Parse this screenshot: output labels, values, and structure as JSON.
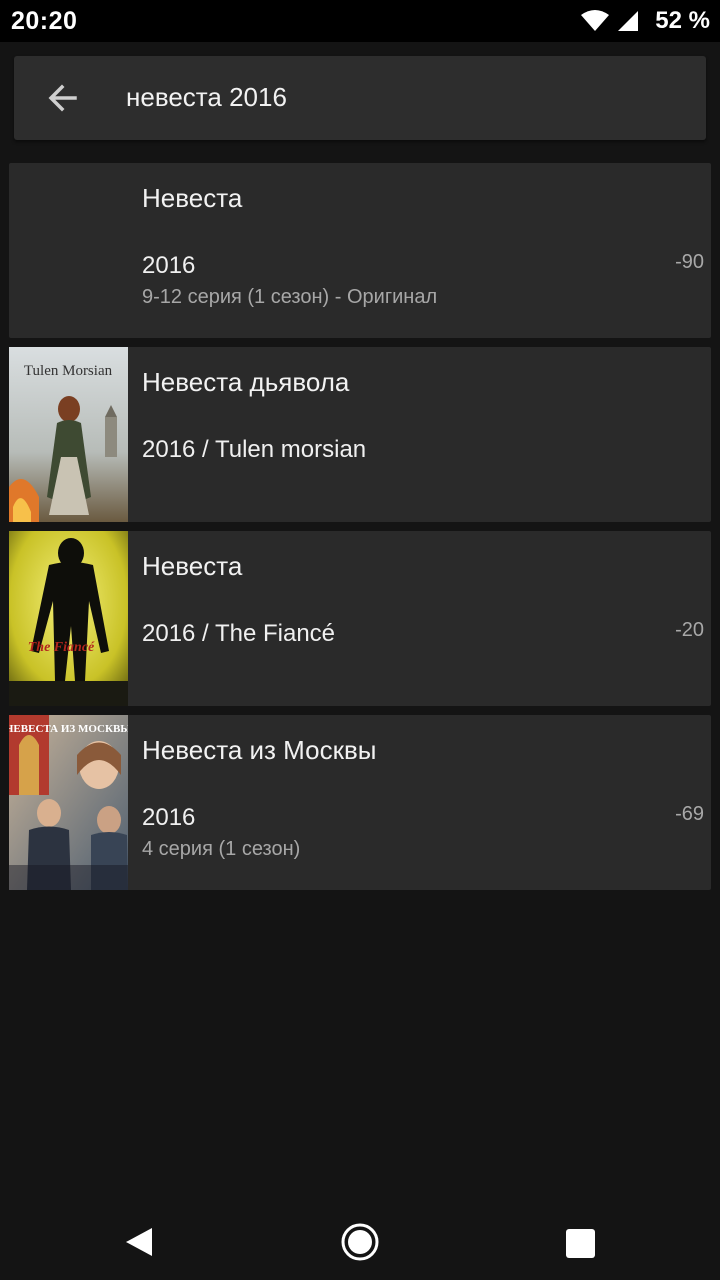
{
  "status": {
    "time": "20:20",
    "battery": "52 %"
  },
  "search": {
    "query": "невеста 2016"
  },
  "results": [
    {
      "title": "Невеста",
      "year": "2016",
      "subtitle": "9-12 серия (1 сезон) - Оригинал",
      "score": "-90",
      "poster": "none"
    },
    {
      "title": "Невеста дьявола",
      "year": "2016 / Tulen morsian",
      "subtitle": "",
      "score": "",
      "poster": "Tulen Morsian"
    },
    {
      "title": "Невеста",
      "year": "2016 / The Fiancé",
      "subtitle": "",
      "score": "-20",
      "poster": "The Fiancé"
    },
    {
      "title": "Невеста из Москвы",
      "year": "2016",
      "subtitle": "4 серия (1 сезон)",
      "score": "-69",
      "poster": "НЕВЕСТА ИЗ МОСКВЫ"
    }
  ],
  "colors": {
    "background": "#141414",
    "card": "#2a2a2a",
    "searchbar": "#2d2d2d",
    "statusbar": "#000000"
  },
  "icons": {
    "back": "arrow-left-icon",
    "wifi": "wifi-icon",
    "signal": "signal-icon",
    "battery": "battery-icon",
    "nav_back": "triangle-back-icon",
    "nav_home": "circle-home-icon",
    "nav_recents": "square-recents-icon"
  }
}
